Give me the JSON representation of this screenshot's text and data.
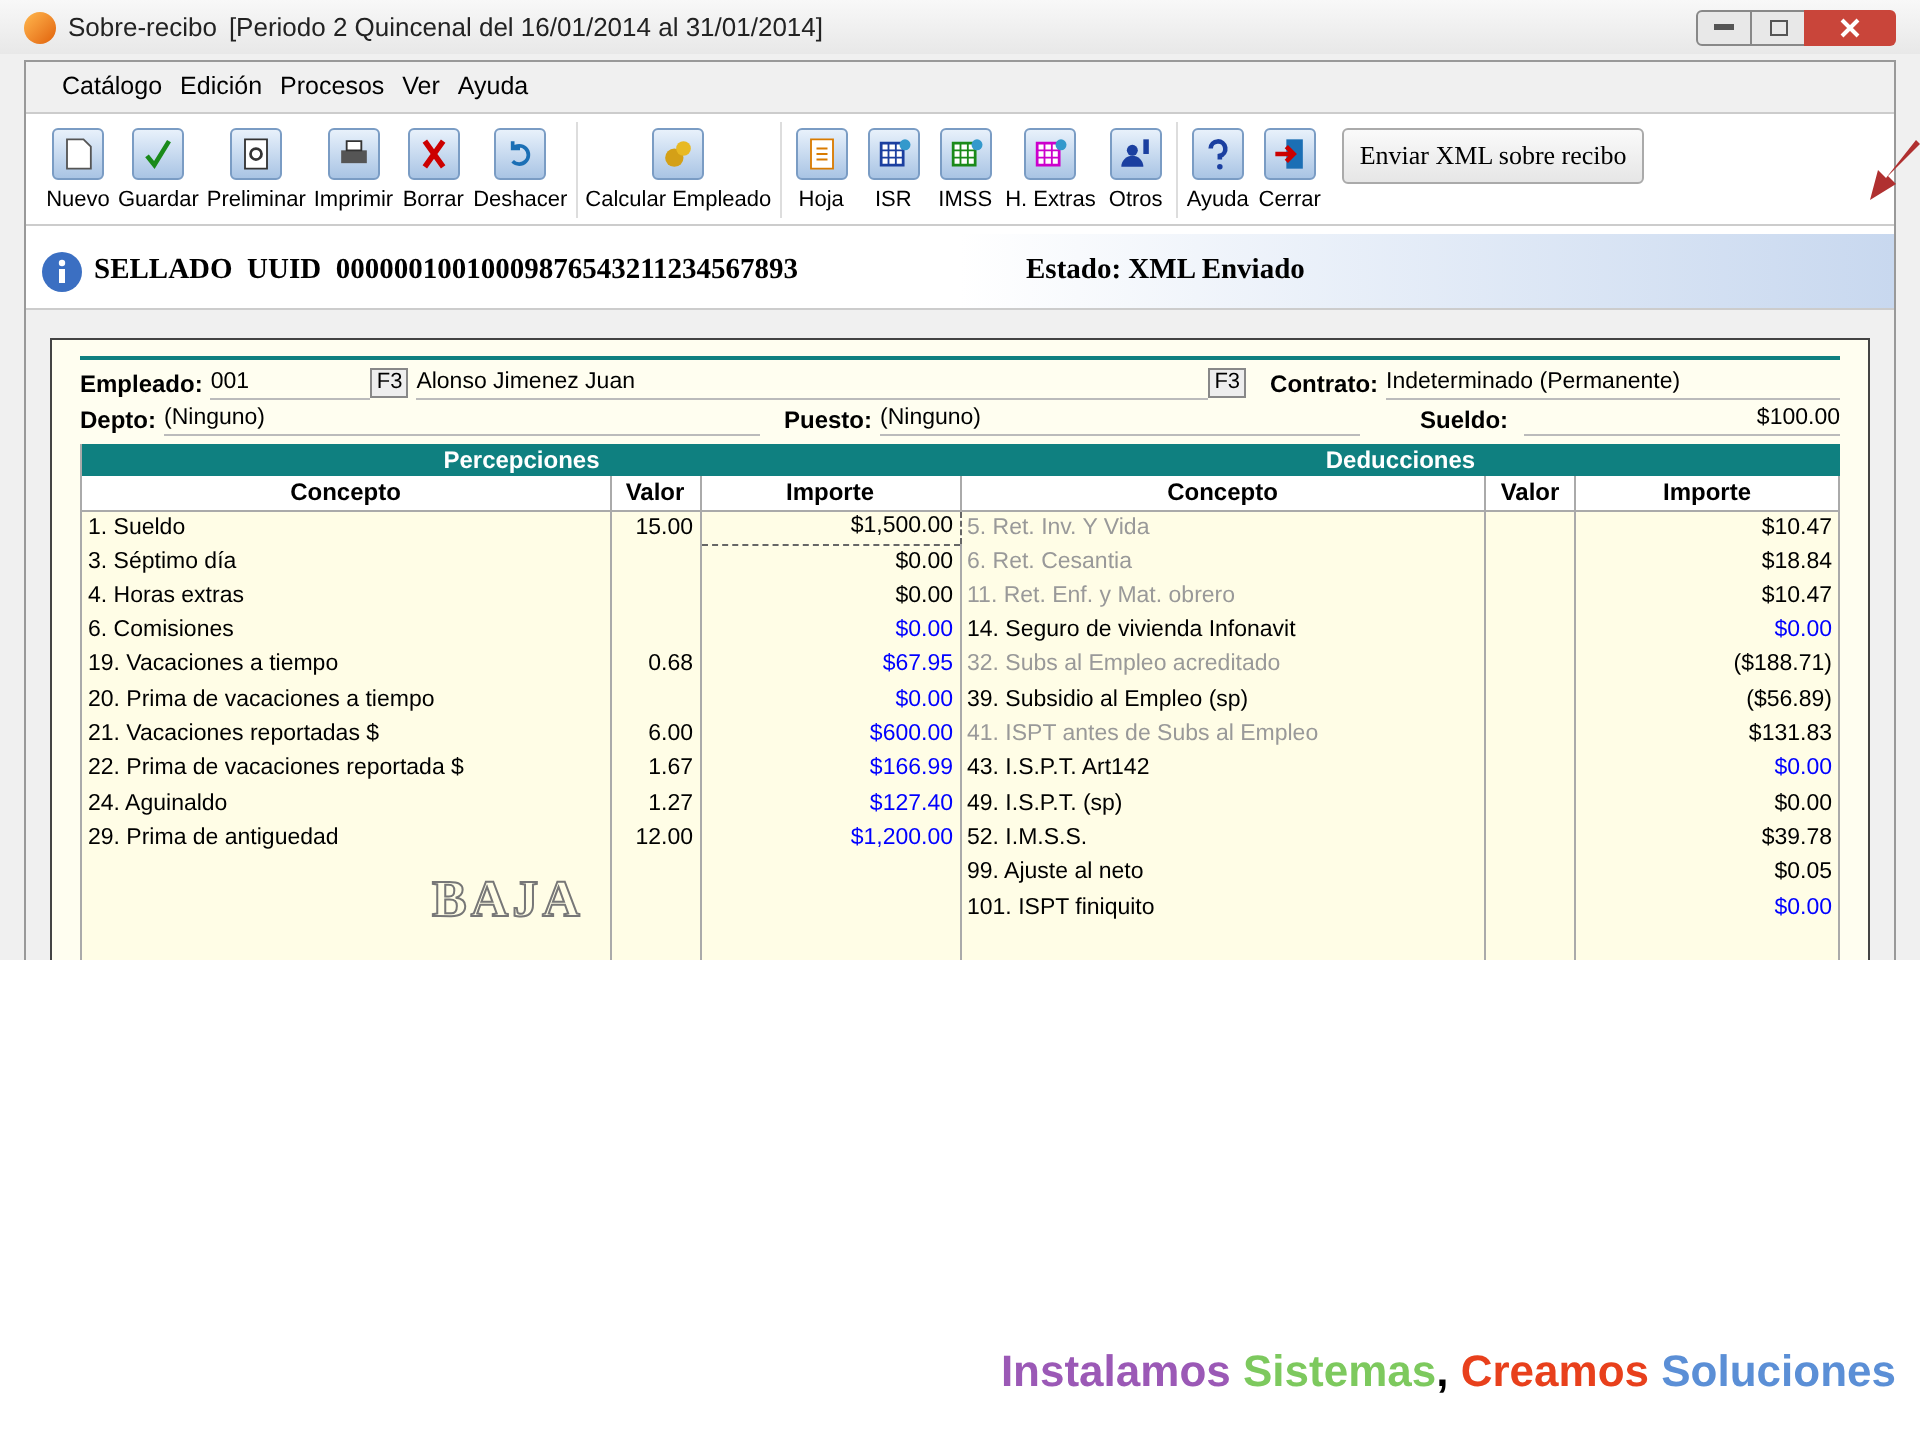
{
  "window": {
    "title": "Sobre-recibo",
    "period": "[Periodo 2 Quincenal del 16/01/2014 al 31/01/2014]"
  },
  "menu": [
    "Catálogo",
    "Edición",
    "Procesos",
    "Ver",
    "Ayuda"
  ],
  "toolbar": {
    "groups": [
      [
        "Nuevo",
        "Guardar",
        "Preliminar",
        "Imprimir",
        "Borrar",
        "Deshacer"
      ],
      [
        "Calcular Empleado"
      ],
      [
        "Hoja",
        "ISR",
        "IMSS",
        "H. Extras",
        "Otros"
      ],
      [
        "Ayuda",
        "Cerrar"
      ]
    ],
    "send_button": "Enviar XML sobre recibo"
  },
  "seal": {
    "text": "SELLADO  UUID  00000010010009876543211234567893",
    "status": "Estado: XML Enviado"
  },
  "form": {
    "employee_label": "Empleado:",
    "employee_code": "001",
    "f3": "F3",
    "employee_name": "Alonso Jimenez Juan",
    "f3_contract": "F3",
    "contract_label": "Contrato:",
    "contract": "Indeterminado (Permanente)",
    "depto_label": "Depto:",
    "depto": "(Ninguno)",
    "puesto_label": "Puesto:",
    "puesto": "(Ninguno)",
    "sueldo_label": "Sueldo:",
    "sueldo": "$100.00"
  },
  "percepciones": {
    "title": "Percepciones",
    "columns": [
      "Concepto",
      "Valor",
      "Importe"
    ],
    "rows": [
      {
        "concepto": "1. Sueldo",
        "valor": "15.00",
        "importe": "$1,500.00",
        "muted": false,
        "color": "#000000",
        "focused": true
      },
      {
        "concepto": "3. Séptimo día",
        "valor": "",
        "importe": "$0.00",
        "muted": false,
        "color": "#000000",
        "focused": false
      },
      {
        "concepto": "4. Horas extras",
        "valor": "",
        "importe": "$0.00",
        "muted": false,
        "color": "#000000",
        "focused": false
      },
      {
        "concepto": "6. Comisiones",
        "valor": "",
        "importe": "$0.00",
        "muted": false,
        "color": "#0000ff",
        "focused": false
      },
      {
        "concepto": "19. Vacaciones a tiempo",
        "valor": "0.68",
        "importe": "$67.95",
        "muted": false,
        "color": "#0000ff",
        "focused": false
      },
      {
        "concepto": "20. Prima de vacaciones a tiempo",
        "valor": "",
        "importe": "$0.00",
        "muted": false,
        "color": "#0000ff",
        "focused": false
      },
      {
        "concepto": "21. Vacaciones reportadas $",
        "valor": "6.00",
        "importe": "$600.00",
        "muted": false,
        "color": "#0000ff",
        "focused": false
      },
      {
        "concepto": "22. Prima de vacaciones reportada $",
        "valor": "1.67",
        "importe": "$166.99",
        "muted": false,
        "color": "#0000ff",
        "focused": false
      },
      {
        "concepto": "24. Aguinaldo",
        "valor": "1.27",
        "importe": "$127.40",
        "muted": false,
        "color": "#0000ff",
        "focused": false
      },
      {
        "concepto": "29. Prima de antiguedad",
        "valor": "12.00",
        "importe": "$1,200.00",
        "muted": false,
        "color": "#0000ff",
        "focused": false
      }
    ]
  },
  "deducciones": {
    "title": "Deducciones",
    "columns": [
      "Concepto",
      "Valor",
      "Importe"
    ],
    "rows": [
      {
        "concepto": "5. Ret. Inv. Y Vida",
        "valor": "",
        "importe": "$10.47",
        "muted": true,
        "color": "#000000",
        "focused": false
      },
      {
        "concepto": "6. Ret. Cesantia",
        "valor": "",
        "importe": "$18.84",
        "muted": true,
        "color": "#000000",
        "focused": false
      },
      {
        "concepto": "11. Ret. Enf. y Mat. obrero",
        "valor": "",
        "importe": "$10.47",
        "muted": true,
        "color": "#000000",
        "focused": false
      },
      {
        "concepto": "14. Seguro de vivienda Infonavit",
        "valor": "",
        "importe": "$0.00",
        "muted": false,
        "color": "#0000ff",
        "focused": false
      },
      {
        "concepto": "32. Subs al Empleo acreditado",
        "valor": "",
        "importe": "($188.71)",
        "muted": true,
        "color": "#000000",
        "focused": false
      },
      {
        "concepto": "39. Subsidio al Empleo (sp)",
        "valor": "",
        "importe": "($56.89)",
        "muted": false,
        "color": "#000000",
        "focused": false
      },
      {
        "concepto": "41. ISPT antes de Subs al Empleo",
        "valor": "",
        "importe": "$131.83",
        "muted": true,
        "color": "#000000",
        "focused": false
      },
      {
        "concepto": "43. I.S.P.T. Art142",
        "valor": "",
        "importe": "$0.00",
        "muted": false,
        "color": "#0000ff",
        "focused": false
      },
      {
        "concepto": "49. I.S.P.T. (sp)",
        "valor": "",
        "importe": "$0.00",
        "muted": false,
        "color": "#000000",
        "focused": false
      },
      {
        "concepto": "52. I.M.S.S.",
        "valor": "",
        "importe": "$39.78",
        "muted": false,
        "color": "#000000",
        "focused": false
      },
      {
        "concepto": "99. Ajuste al neto",
        "valor": "",
        "importe": "$0.05",
        "muted": false,
        "color": "#000000",
        "focused": false
      },
      {
        "concepto": "101. ISPT finiquito",
        "valor": "",
        "importe": "$0.00",
        "muted": false,
        "color": "#0000ff",
        "focused": false
      }
    ]
  },
  "stamp": "BAJA",
  "slogan": [
    {
      "text": "Instalamos",
      "color": "#9b59b6"
    },
    {
      "text": "Sistemas",
      "color": "#7dc95e"
    },
    {
      "text": ",",
      "color": "#000000"
    },
    {
      "text": "Creamos",
      "color": "#e8401c"
    },
    {
      "text": "Soluciones",
      "color": "#5b8fd6"
    }
  ]
}
